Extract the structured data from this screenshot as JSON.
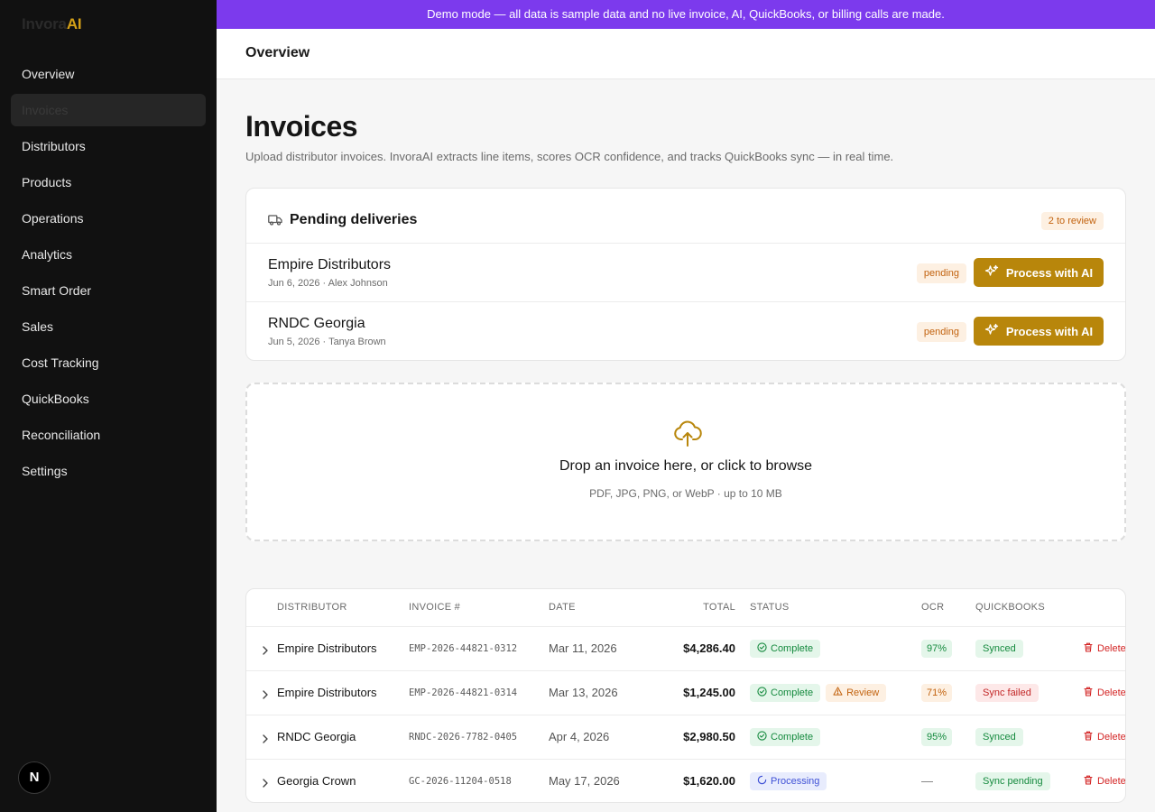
{
  "app": {
    "logo_part1": "Invora",
    "logo_part2": "AI",
    "user_initial": "N"
  },
  "banner": {
    "text": "Demo mode — all data is sample data and no live invoice, AI, QuickBooks, or billing calls are made."
  },
  "sidebar": {
    "items": [
      {
        "label": "Overview"
      },
      {
        "label": "Invoices"
      },
      {
        "label": "Distributors"
      },
      {
        "label": "Products"
      },
      {
        "label": "Operations"
      },
      {
        "label": "Analytics"
      },
      {
        "label": "Smart Order"
      },
      {
        "label": "Sales"
      },
      {
        "label": "Cost Tracking"
      },
      {
        "label": "QuickBooks"
      },
      {
        "label": "Reconciliation"
      },
      {
        "label": "Settings"
      }
    ]
  },
  "header": {
    "title": "Overview"
  },
  "page": {
    "title": "Invoices",
    "subtitle": "Upload distributor invoices. InvoraAI extracts line items, scores OCR confidence, and tracks QuickBooks sync — in real time."
  },
  "pending": {
    "title": "Pending deliveries",
    "badge": "2 to review",
    "rows": [
      {
        "name": "Empire Distributors",
        "meta": "Jun 6, 2026 · Alex Johnson",
        "status": "pending",
        "button": "Process with AI"
      },
      {
        "name": "RNDC Georgia",
        "meta": "Jun 5, 2026 · Tanya Brown",
        "status": "pending",
        "button": "Process with AI"
      }
    ]
  },
  "dropzone": {
    "title": "Drop an invoice here, or click to browse",
    "subtitle": "PDF, JPG, PNG, or WebP · up to 10 MB"
  },
  "table": {
    "headers": [
      "DISTRIBUTOR",
      "INVOICE #",
      "DATE",
      "TOTAL",
      "STATUS",
      "OCR",
      "QUICKBOOKS"
    ],
    "delete_label": "Delete",
    "rows": [
      {
        "distributor": "Empire Distributors",
        "invoice": "EMP-2026-44821-0312",
        "date": "Mar 11, 2026",
        "total": "$4,286.40",
        "status": "Complete",
        "review": "",
        "ocr": "97%",
        "qb": "Synced"
      },
      {
        "distributor": "Empire Distributors",
        "invoice": "EMP-2026-44821-0314",
        "date": "Mar 13, 2026",
        "total": "$1,245.00",
        "status": "Complete",
        "review": "Review",
        "ocr": "71%",
        "qb": "Sync failed"
      },
      {
        "distributor": "RNDC Georgia",
        "invoice": "RNDC-2026-7782-0405",
        "date": "Apr 4, 2026",
        "total": "$2,980.50",
        "status": "Complete",
        "review": "",
        "ocr": "95%",
        "qb": "Synced"
      },
      {
        "distributor": "Georgia Crown",
        "invoice": "GC-2026-11204-0518",
        "date": "May 17, 2026",
        "total": "$1,620.00",
        "status": "Processing",
        "review": "",
        "ocr": "—",
        "qb": "Sync pending"
      }
    ]
  },
  "colors": {
    "banner": "#7c3aed",
    "accent": "#b8860b",
    "sidebar": "#111111",
    "success": "#158a3e",
    "danger": "#d32424",
    "warning": "#c2620e",
    "info": "#3f51d6"
  },
  "icons": {
    "pending_header": "truck-icon",
    "process_button": "sparkles-icon",
    "dropzone": "cloud-upload-icon",
    "row_expand": "chevron-right-icon",
    "complete": "check-circle-icon",
    "review": "warning-triangle-icon",
    "processing": "spinner-icon",
    "delete": "trash-icon"
  }
}
